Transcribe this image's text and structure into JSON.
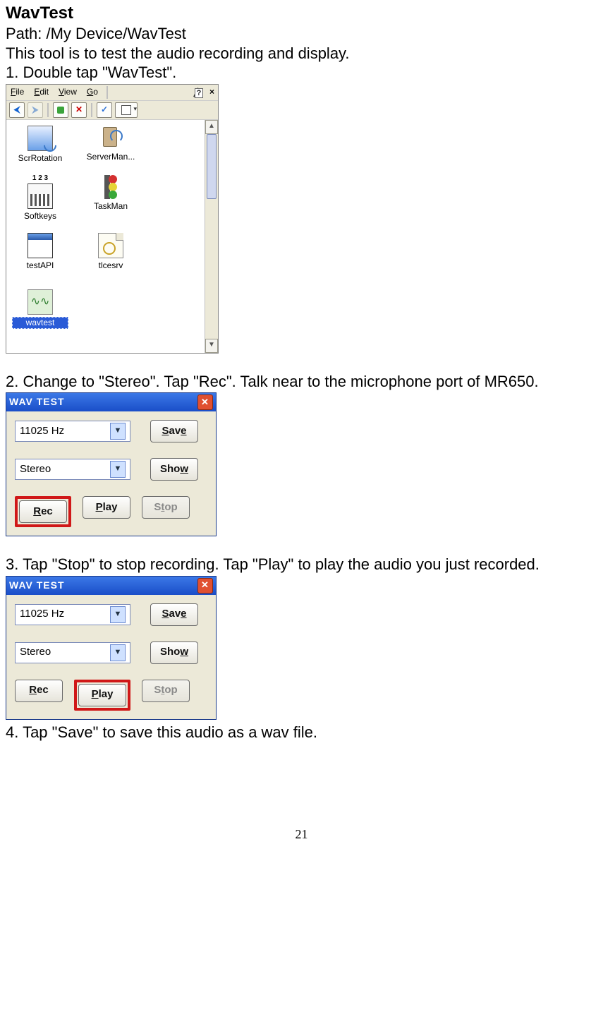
{
  "doc": {
    "title": "WavTest",
    "path_line": "Path: /My Device/WavTest",
    "intro": "This tool is to test the audio recording and display.",
    "step1": "1. Double tap \"WavTest\".",
    "step2": "2. Change to \"Stereo\". Tap \"Rec\". Talk near to the microphone port of MR650.",
    "step3": "3. Tap \"Stop\" to stop recording. Tap \"Play\" to play the audio you just recorded.",
    "step4": "4. Tap \"Save\" to save this audio as a wav file.",
    "page_number": "21"
  },
  "explorer": {
    "menus": {
      "file": "File",
      "edit": "Edit",
      "view": "View",
      "go": "Go"
    },
    "items": [
      {
        "name": "ScrRotation"
      },
      {
        "name": "ServerMan..."
      },
      {
        "name": "Softkeys"
      },
      {
        "name": "TaskMan"
      },
      {
        "name": "testAPI"
      },
      {
        "name": "tlcesrv"
      },
      {
        "name": "wavtest"
      }
    ],
    "selected": "wavtest"
  },
  "wav": {
    "title": "WAV TEST",
    "freq": "11025 Hz",
    "mode": "Stereo",
    "buttons": {
      "save": "Save",
      "show": "Show",
      "rec": "Rec",
      "play": "Play",
      "stop": "Stop"
    }
  }
}
